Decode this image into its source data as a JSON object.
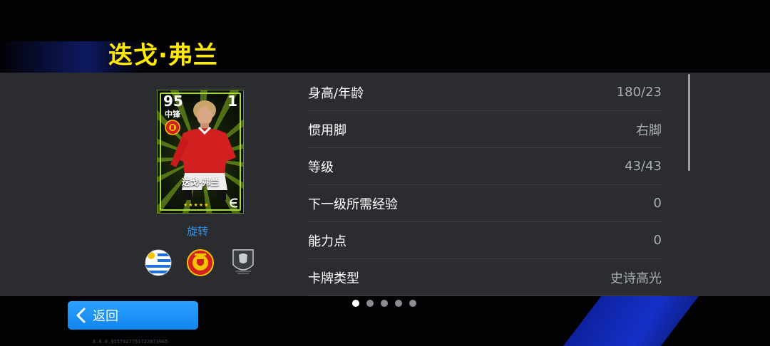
{
  "header": {
    "player_name": "迭戈·弗兰"
  },
  "card": {
    "rating": "95",
    "position": "中锋",
    "number": "1",
    "name": "迭戈·弗兰",
    "stars": "★★★★★",
    "frame_color": "#a8d83a"
  },
  "rotate_label": "旋转",
  "icons": {
    "nationality": "uruguay-flag-icon",
    "club": "manchester-united-badge-icon",
    "league": "english-league-icon"
  },
  "stats": [
    {
      "label": "身高/年龄",
      "value": "180/23"
    },
    {
      "label": "惯用脚",
      "value": "右脚"
    },
    {
      "label": "等级",
      "value": "43/43"
    },
    {
      "label": "下一级所需经验",
      "value": "0"
    },
    {
      "label": "能力点",
      "value": "0"
    },
    {
      "label": "卡牌类型",
      "value": "史诗高光"
    }
  ],
  "pagination": {
    "total": 5,
    "current": 1
  },
  "back_button": {
    "label": "返回"
  },
  "version": "8.6.0.9157427751722073965",
  "colors": {
    "title": "#ffea00",
    "accent": "#1186f0",
    "panel": "#2a2c2f"
  }
}
